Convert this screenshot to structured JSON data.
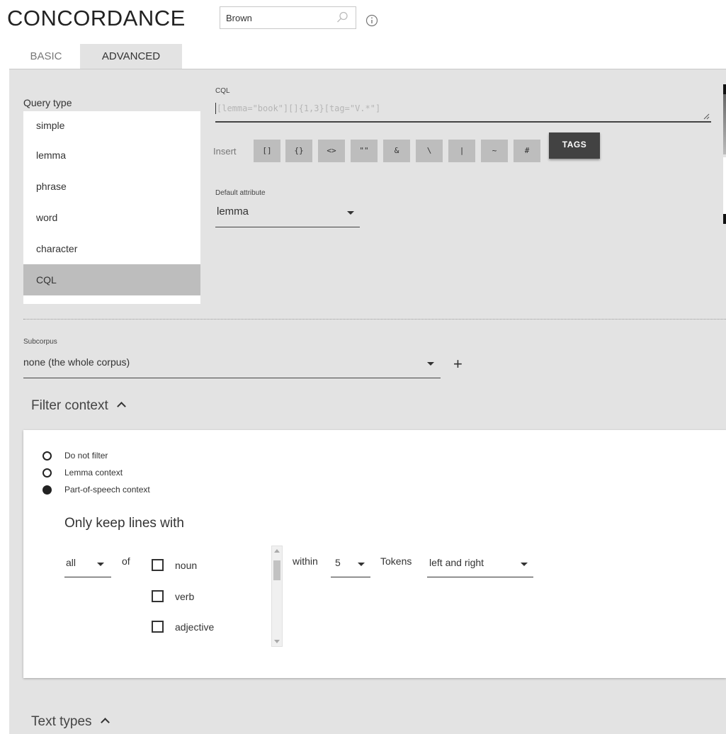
{
  "app_title": "CONCORDANCE",
  "corpus": {
    "value": "Brown"
  },
  "tabs": {
    "basic": "BASIC",
    "advanced": "ADVANCED"
  },
  "query_type": {
    "label": "Query type",
    "items": [
      "simple",
      "lemma",
      "phrase",
      "word",
      "character",
      "CQL"
    ],
    "selected": "CQL"
  },
  "cql": {
    "label": "CQL",
    "placeholder": "[lemma=\"book\"][]{1,3}[tag=\"V.*\"]"
  },
  "insert": {
    "label": "Insert",
    "buttons": [
      "[]",
      "{}",
      "<>",
      "\"\"",
      "&",
      "\\",
      "|",
      "~",
      "#"
    ],
    "tags_label": "TAGS"
  },
  "default_attribute": {
    "label": "Default attribute",
    "value": "lemma"
  },
  "subcorpus": {
    "label": "Subcorpus",
    "value": "none (the whole corpus)",
    "add_label": "+"
  },
  "filter_context": {
    "title": "Filter context",
    "options": [
      "Do not filter",
      "Lemma context",
      "Part-of-speech context"
    ],
    "selected": "Part-of-speech context",
    "only_keep_label": "Only keep lines with",
    "quantifier": "all",
    "of_label": "of",
    "pos_options": [
      "noun",
      "verb",
      "adjective"
    ],
    "within_label": "within",
    "window_size": "5",
    "tokens_label": "Tokens",
    "direction": "left and right"
  },
  "text_types": {
    "title": "Text types"
  },
  "colors": {
    "panel": "#e3e3e3",
    "selected_item": "#bdbdbd",
    "tags_button": "#424242"
  }
}
